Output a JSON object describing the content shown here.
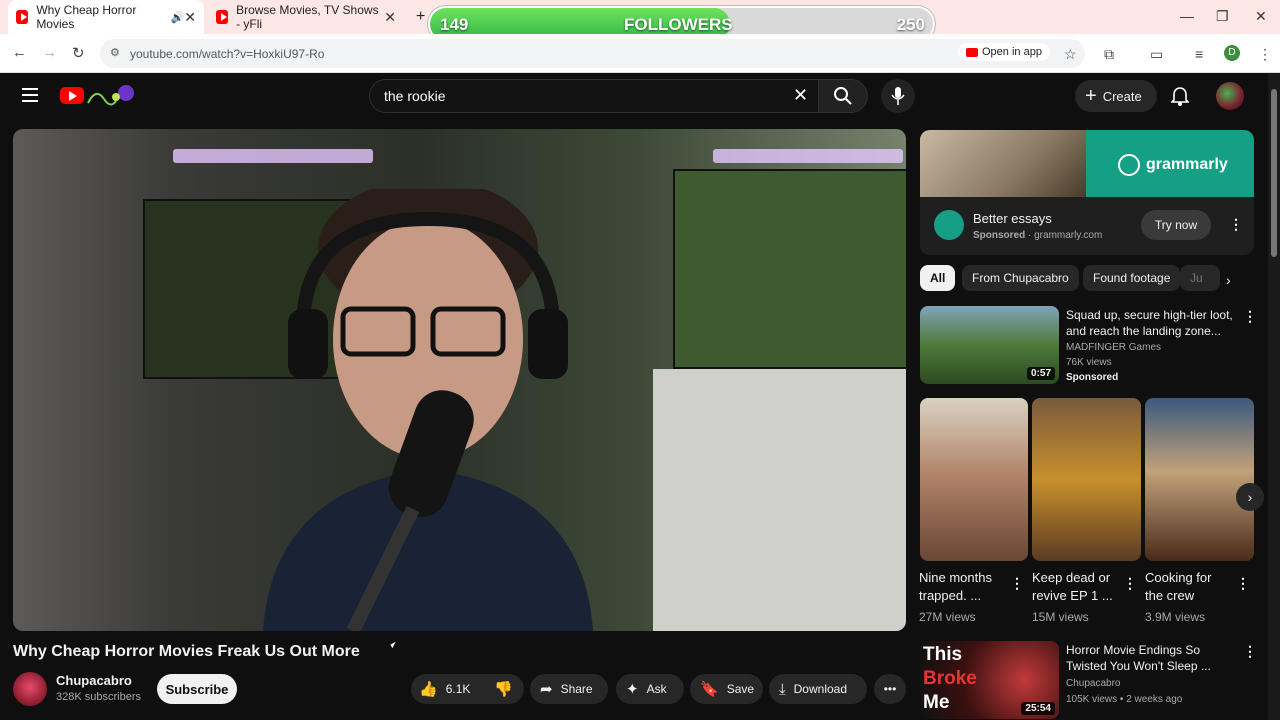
{
  "browser": {
    "tabs": [
      {
        "title": "Why Cheap Horror Movies",
        "active": true
      },
      {
        "title": "Browse Movies, TV Shows - yFli",
        "active": false
      }
    ],
    "url": "youtube.com/watch?v=HoxkiU97-Ro",
    "open_in_app": "Open in app",
    "profile_initial": "D"
  },
  "overlay": {
    "start": "149",
    "label": "FOLLOWERS",
    "goal": "250",
    "progress": 0.596
  },
  "header": {
    "search_query": "the rookie",
    "create_label": "Create"
  },
  "video": {
    "title": "Why Cheap Horror Movies Freak Us Out More",
    "channel": "Chupacabro",
    "subscribers": "328K subscribers",
    "subscribe_label": "Subscribe",
    "likes": "6.1K",
    "share_label": "Share",
    "ask_label": "Ask",
    "save_label": "Save",
    "download_label": "Download"
  },
  "ad": {
    "brand": "grammarly",
    "title": "Better essays",
    "sponsored": "Sponsored",
    "domain": "grammarly.com",
    "cta": "Try now"
  },
  "chips": [
    "All",
    "From Chupacabro",
    "Found footage",
    "Ju"
  ],
  "recommendations": {
    "sponsored_video": {
      "title": "Squad up, secure high-tier loot, and reach the landing zone...",
      "channel": "MADFINGER Games",
      "views": "76K views",
      "label": "Sponsored",
      "duration": "0:57"
    },
    "shorts": [
      {
        "title": "Nine months trapped. ...",
        "views": "27M views"
      },
      {
        "title": "Keep dead or revive EP 1 ...",
        "views": "15M views"
      },
      {
        "title": "Cooking for the crew",
        "views": "3.9M views"
      }
    ],
    "video2": {
      "title": "Horror Movie Endings So Twisted You Won't Sleep ...",
      "channel": "Chupacabro",
      "meta": "105K views • 2 weeks ago",
      "duration": "25:54",
      "thumb_text": [
        "This",
        "Broke",
        "Me"
      ]
    }
  },
  "colors": {
    "accent": "#ff0000",
    "background": "#0f0f0f",
    "progress_green": "#3cc24e",
    "grammarly_teal": "#15a085"
  }
}
